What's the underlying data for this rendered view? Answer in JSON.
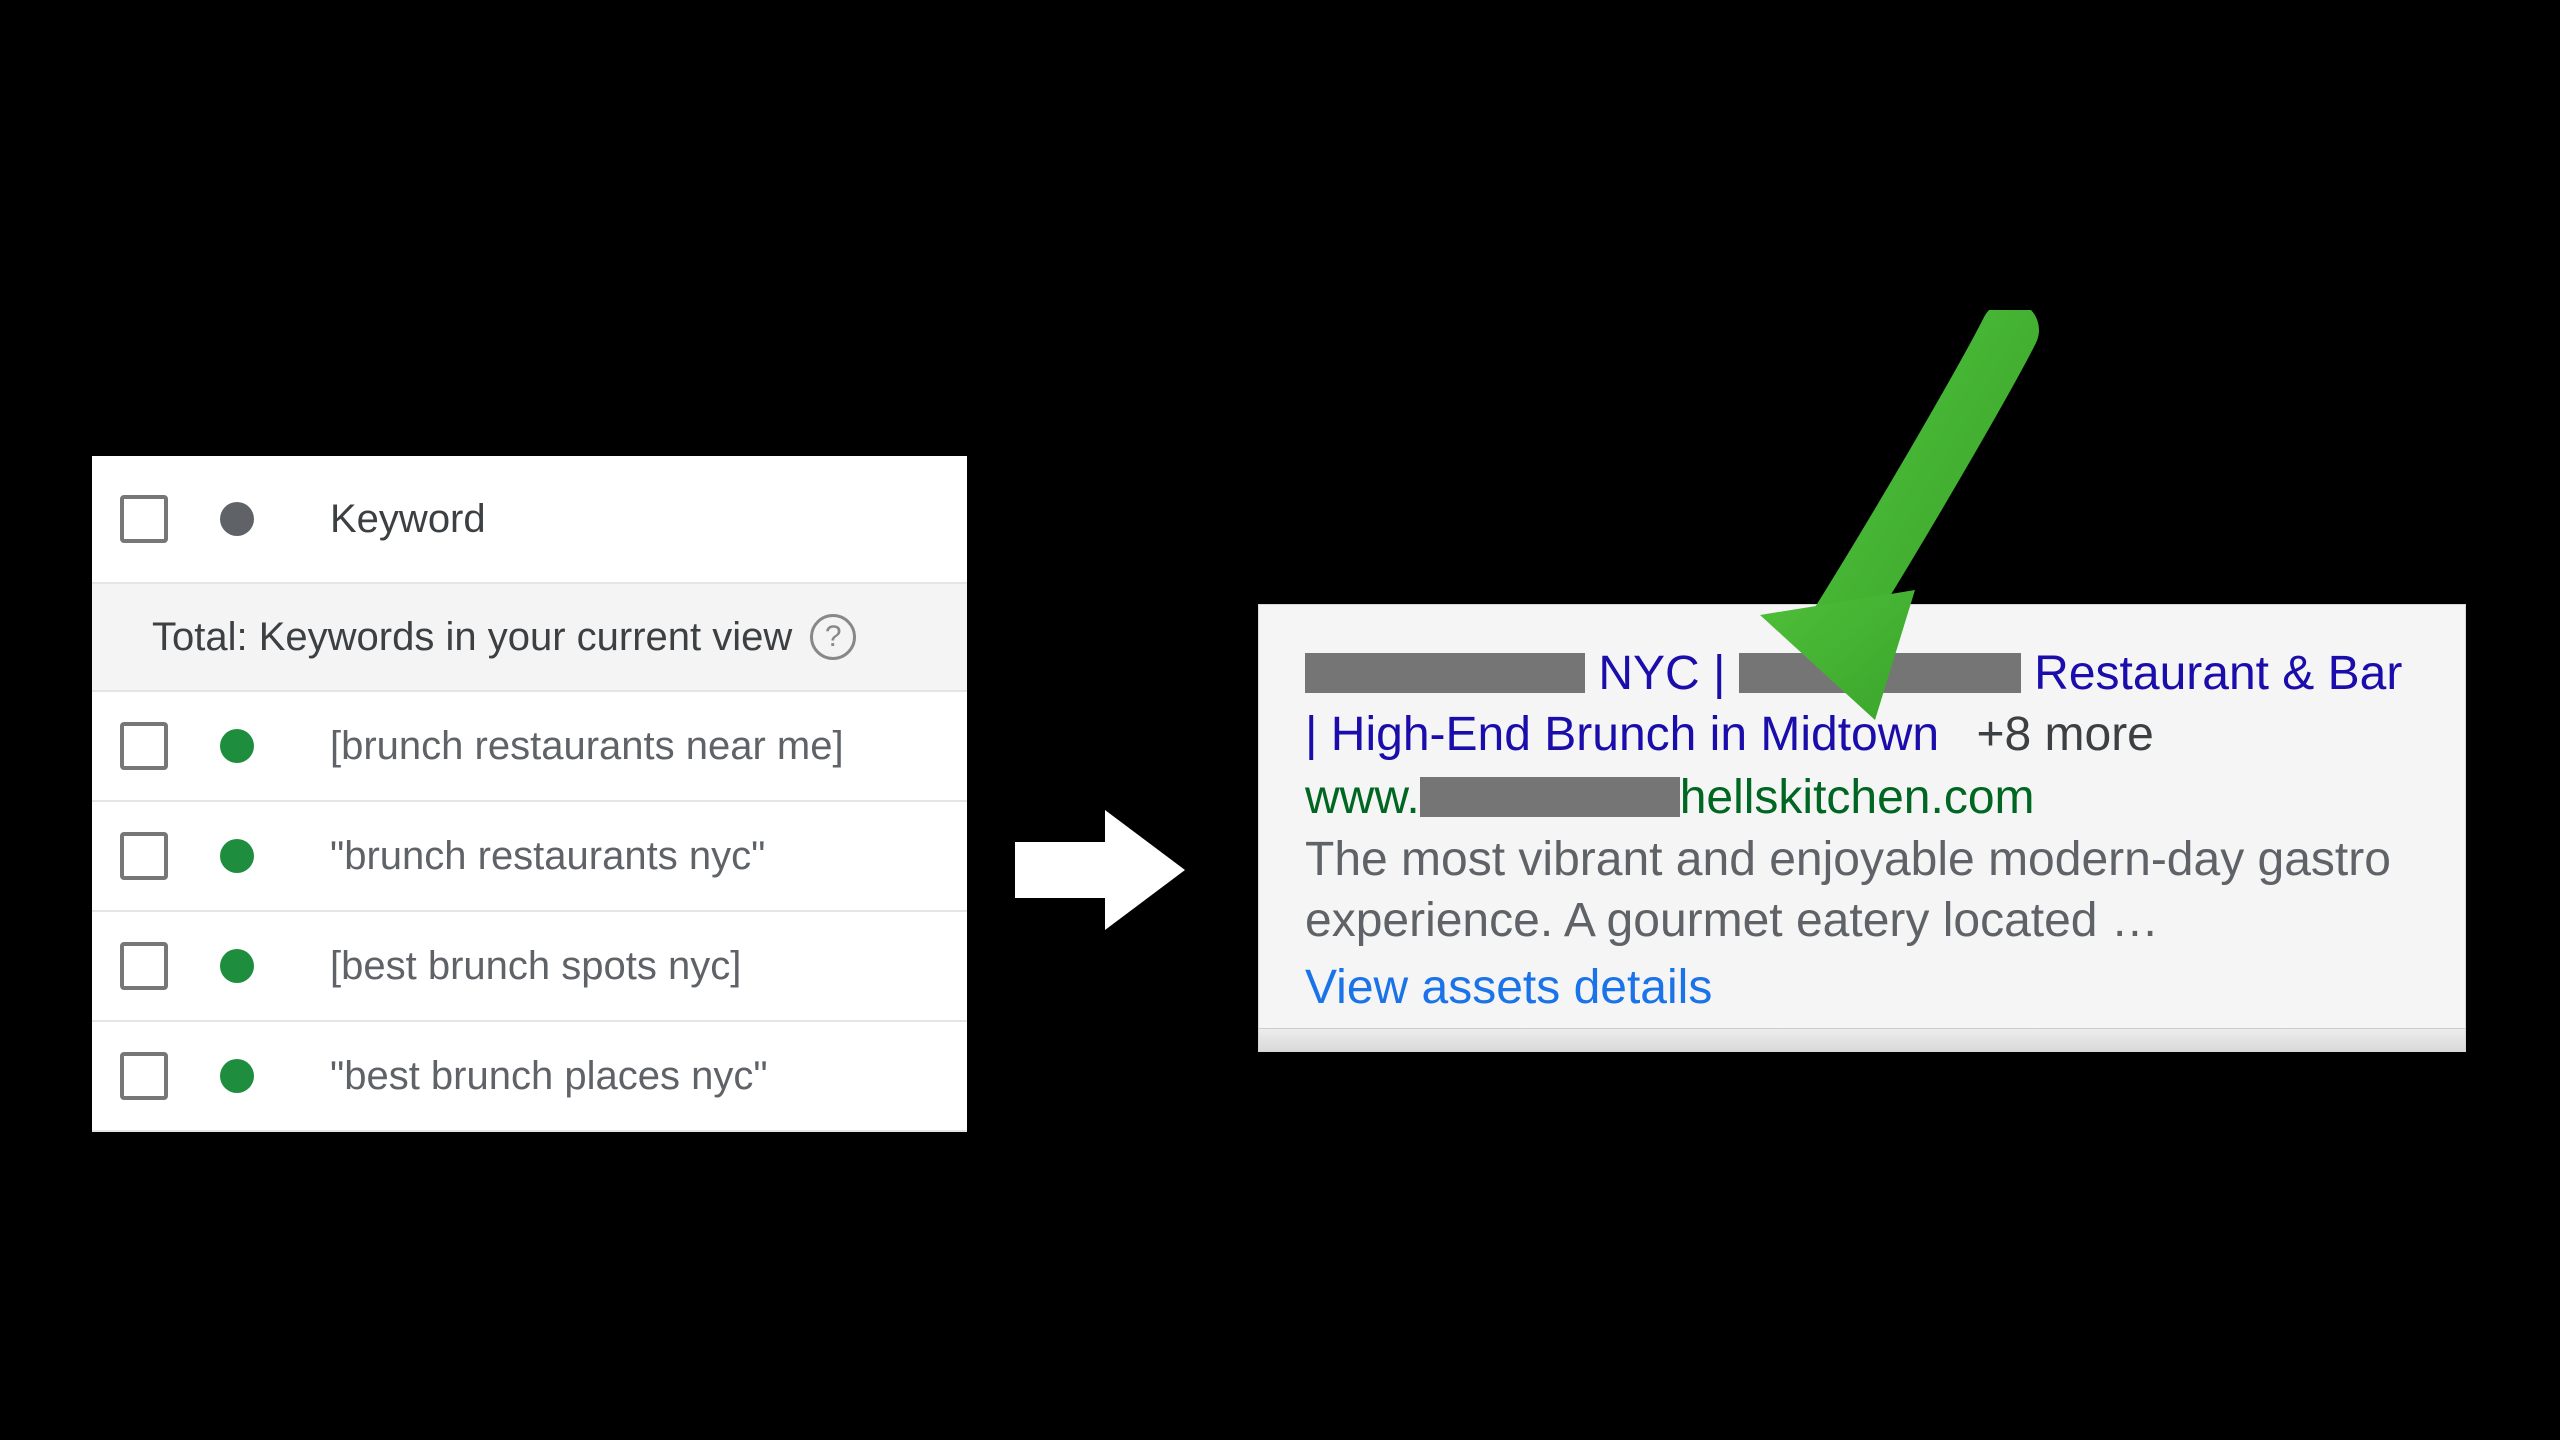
{
  "keyword_panel": {
    "header_label": "Keyword",
    "total_label": "Total: Keywords in your current view",
    "rows": [
      {
        "status": "green",
        "text": "[brunch restaurants near me]"
      },
      {
        "status": "green",
        "text": "\"brunch restaurants nyc\""
      },
      {
        "status": "green",
        "text": "[best brunch spots nyc]"
      },
      {
        "status": "green",
        "text": "\"best brunch places nyc\""
      }
    ]
  },
  "ad": {
    "headline_part1": " NYC | ",
    "headline_part2": "Restaurant & Bar | High-End Brunch in Midtown",
    "more_count": "+8 more",
    "url_prefix": "www.",
    "url_suffix": "hellskitchen.com",
    "description": "The most vibrant and enjoyable modern-day gastro experience. A gourmet eatery located …",
    "assets_link": "View assets details"
  }
}
